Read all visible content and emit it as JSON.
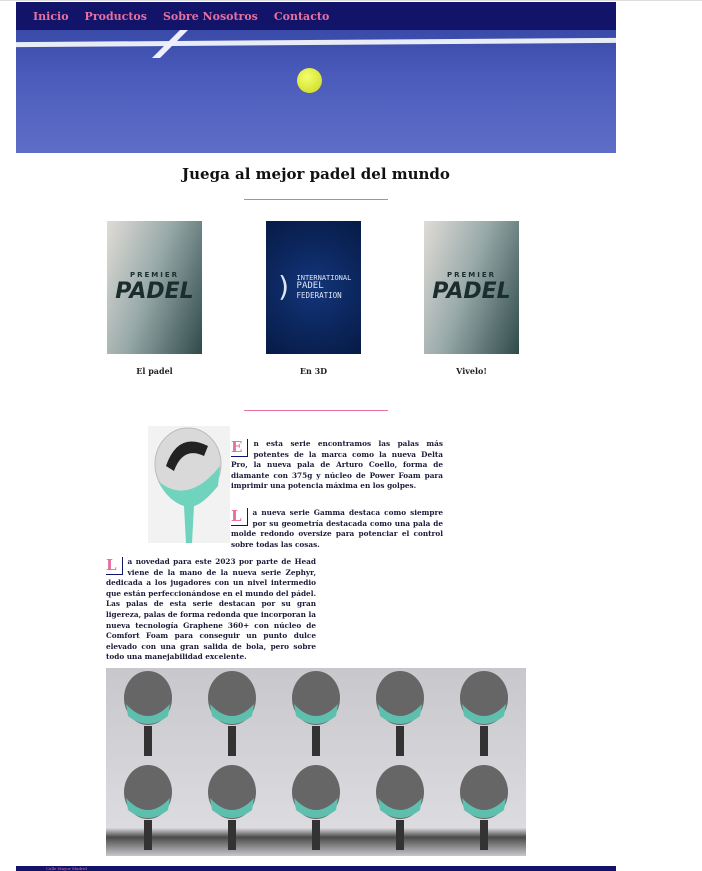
{
  "nav": {
    "items": [
      "Inicio",
      "Productos",
      "Sobre Nosotros",
      "Contacto"
    ]
  },
  "hero": {
    "image": "padel-court-ball"
  },
  "title": "Juega al mejor padel del mundo",
  "cards": [
    {
      "image": "premier-padel-logo",
      "logo_text": [
        "PREMIER",
        "PADEL"
      ],
      "caption": "El padel"
    },
    {
      "image": "international-padel-federation-logo",
      "logo_text": [
        "INTERNATIONAL",
        "PADEL",
        "FEDERATION"
      ],
      "caption": "En 3D"
    },
    {
      "image": "premier-padel-logo",
      "logo_text": [
        "PREMIER",
        "PADEL"
      ],
      "caption": "Vivelo!"
    }
  ],
  "paragraphs": [
    {
      "initial": "E",
      "text": "n esta serie encontramos las palas más potentes de la marca como la nueva Delta Pro, la nueva pala de Arturo Coello, forma de diamante con 375g y núcleo de Power Foam para imprimir una potencia máxima en los golpes."
    },
    {
      "initial": "L",
      "text": "a nueva serie Gamma destaca como siempre por su geometría destacada como una pala de molde redondo oversize para potenciar el control sobre todas las cosas."
    },
    {
      "initial": "L",
      "text": "a novedad para este 2023 por parte de Head viene de la mano de la nueva serie Zephyr, dedicada a los jugadores con un nivel intermedio que están perfeccionándose en el mundo del pádel. Las palas de esta serie destacan por su gran ligereza, palas de forma redonda que incorporan la nueva tecnología Graphene 360+ con núcleo de Comfort Foam para conseguir un punto dulce elevado con una gran salida de bola, pero sobre todo una manejabilidad excelente."
    }
  ],
  "footer": {
    "text": "Calle Mayor Madrid"
  },
  "colors": {
    "nav_bg": "#12146a",
    "accent": "#e66fa0"
  }
}
